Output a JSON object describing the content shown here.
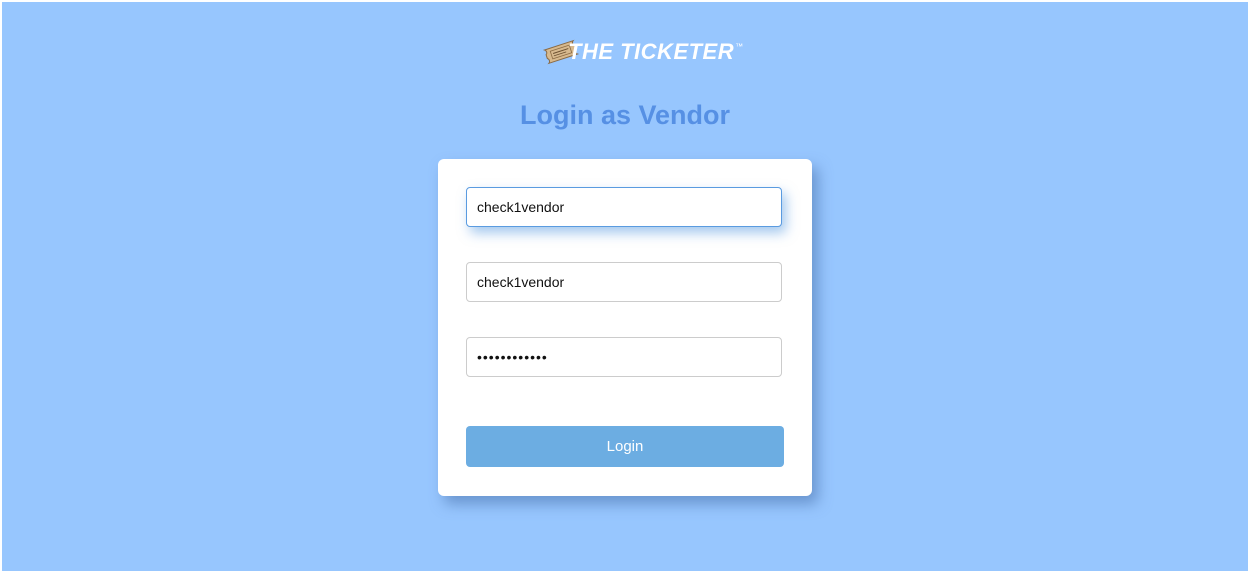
{
  "brand": {
    "logo_text": "THE TICKETER",
    "trademark": "™"
  },
  "page": {
    "title": "Login as Vendor"
  },
  "form": {
    "field1_value": "check1vendor",
    "field2_value": "check1vendor",
    "password_value": "check1vendor",
    "submit_label": "Login"
  },
  "colors": {
    "background": "#97c6fe",
    "title": "#5690e4",
    "button": "#6cade2",
    "focus_border": "#5a9be0"
  },
  "icons": {
    "logo": "ticket-icon"
  }
}
